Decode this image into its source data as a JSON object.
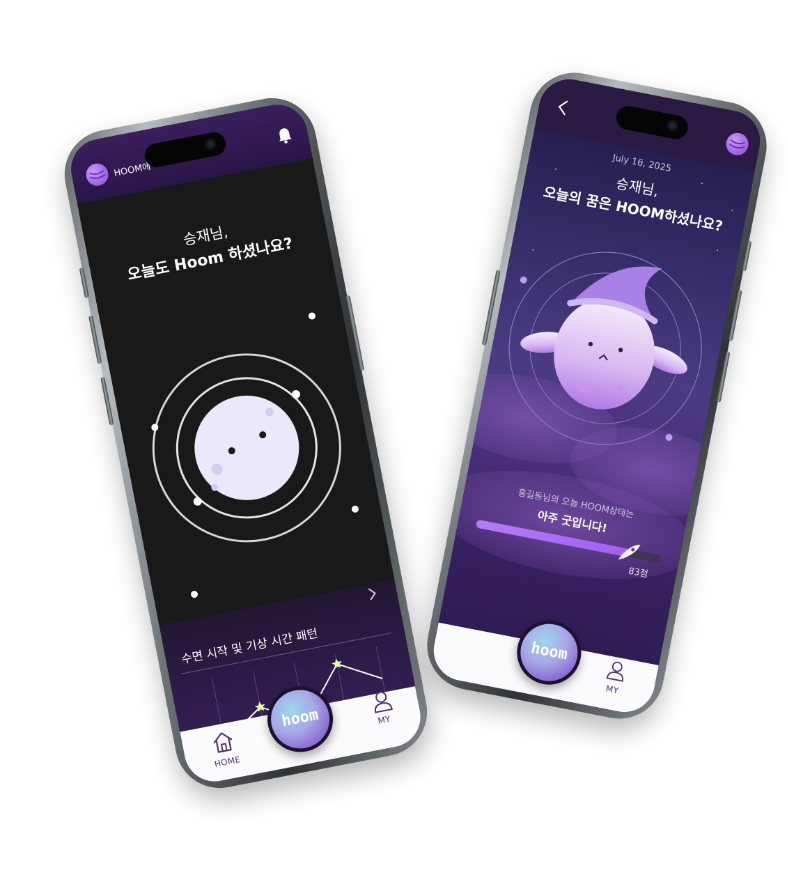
{
  "phone_home": {
    "header": {
      "app_name": "HOOM에",
      "icon": "bell-icon"
    },
    "greeting": {
      "line1": "승재님,",
      "line2": "오늘도 Hoom 하셨나요?"
    },
    "section": {
      "title": "수면 시작 및 기상 시간 패턴",
      "chevron": "chevron-right-icon"
    },
    "chart_data": {
      "type": "line",
      "title": "수면 시작 및 기상 시간 패턴",
      "x": [
        0,
        1,
        2,
        3,
        4
      ],
      "values": [
        0.15,
        0.52,
        0.22,
        0.88,
        0.58
      ],
      "grid": true
    },
    "nav": {
      "home_label": "HOME",
      "my_label": "MY",
      "center_logo": "hoom"
    }
  },
  "phone_detail": {
    "date": "July 16, 2025",
    "greeting": {
      "line1": "승재님,",
      "line2": "오늘의 꿈은 HOOM하셨나요?"
    },
    "status": {
      "line1": "홍길동님의 오늘 HOOM상태는",
      "line2": "아주 굿입니다!"
    },
    "score": {
      "value": 83,
      "label": "83점",
      "max": 100
    },
    "nav": {
      "my_label": "MY",
      "center_logo": "hoom"
    },
    "colors": {
      "accent": "#a35ef0",
      "background": "#332a66"
    }
  }
}
